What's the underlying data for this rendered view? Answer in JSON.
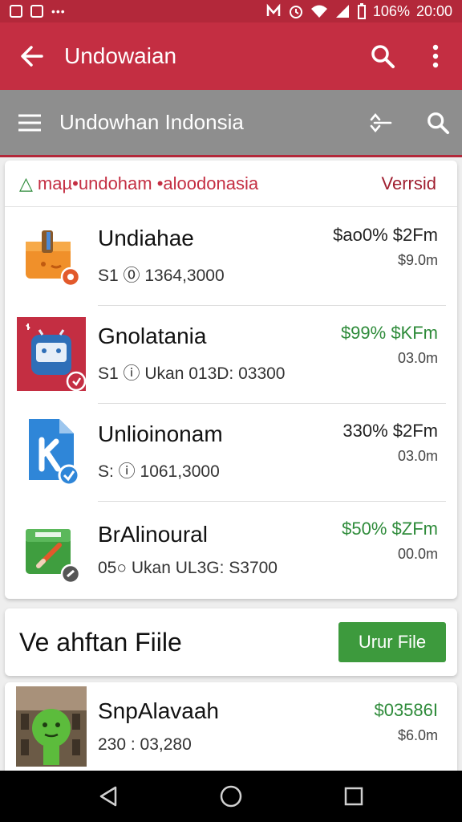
{
  "status_bar": {
    "battery": "106%",
    "time": "20:00"
  },
  "app_bar": {
    "title": "Undowaian"
  },
  "sub_bar": {
    "title": "Undowhan Indonsia"
  },
  "list_card": {
    "header_lead": "△",
    "header_title": "maµ•undoham •aloodonasia",
    "header_right": "Verrsid",
    "items": [
      {
        "name": "Undiahae",
        "meta": "S1 ⓪ 1364,3000",
        "price": "$ао0% $2Fm",
        "sub": "$9.0m",
        "price_color": "#222222",
        "icon": "orange-box-icon"
      },
      {
        "name": "Gnolatania",
        "meta": "S1 ⓘ Ukan 013D: 03300",
        "price": "$99% $KFm",
        "sub": "03.0m",
        "price_color": "#2e8b3a",
        "icon": "blue-robot-icon"
      },
      {
        "name": "Unlioinonam",
        "meta": "S: ⓘ 1061,3000",
        "price": "330% $2Fm",
        "sub": "03.0m",
        "price_color": "#222222",
        "icon": "document-k-icon"
      },
      {
        "name": "BrAlinoural",
        "meta": "05○ Ukan UL3G: S3700",
        "price": "$50% $ZFm",
        "sub": "00.0m",
        "price_color": "#2e8b3a",
        "icon": "green-box-icon"
      }
    ]
  },
  "section": {
    "title": "Ve ahftan Fiile",
    "button": "Urur File"
  },
  "bottom_item": {
    "name": "SnpAlavaah",
    "meta": "230 : 03,280",
    "price": "$03586I",
    "sub": "$6.0m"
  },
  "colors": {
    "primary": "#c42e42",
    "primary_dark": "#b3283a",
    "subbar": "#8e8e8e",
    "green": "#3d9a3d"
  }
}
